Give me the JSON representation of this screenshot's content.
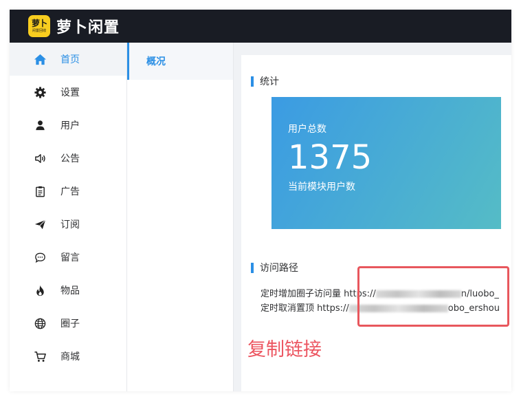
{
  "app": {
    "logo_line1": "萝卜",
    "logo_line2": "闲置回收",
    "title": "萝卜闲置"
  },
  "sidebar": {
    "items": [
      {
        "label": "首页",
        "icon": "home-icon",
        "active": true
      },
      {
        "label": "设置",
        "icon": "gear-icon"
      },
      {
        "label": "用户",
        "icon": "user-icon"
      },
      {
        "label": "公告",
        "icon": "speaker-icon"
      },
      {
        "label": "广告",
        "icon": "clipboard-icon"
      },
      {
        "label": "订阅",
        "icon": "paper-plane-icon"
      },
      {
        "label": "留言",
        "icon": "chat-bubble-icon"
      },
      {
        "label": "物品",
        "icon": "fire-icon"
      },
      {
        "label": "圈子",
        "icon": "globe-icon"
      },
      {
        "label": "商城",
        "icon": "cart-icon"
      }
    ]
  },
  "subnav": {
    "active_label": "概况"
  },
  "stats": {
    "section_title": "统计",
    "card_label": "用户总数",
    "card_value": "1375",
    "card_desc": "当前模块用户数"
  },
  "routes": {
    "section_title": "访问路径",
    "line1_label": "定时增加圈子访问量",
    "line1_prefix": "https://",
    "line1_suffix": "n/luobo_",
    "line2_label": "定时取消置顶",
    "line2_prefix": "https://",
    "line2_suffix": "obo_ershou"
  },
  "annotation": {
    "text": "复制链接"
  },
  "colors": {
    "header_bg": "#191c24",
    "accent": "#2b8fe5",
    "logo_bg": "#f8cd1f",
    "annotation": "#ec5560"
  }
}
